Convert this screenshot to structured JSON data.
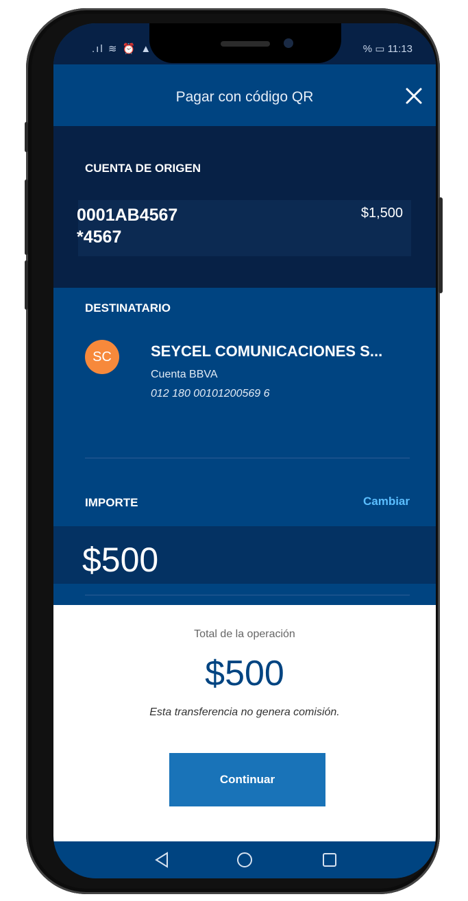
{
  "status_bar": {
    "left_icons": ".ıl ≋ ⏰ ▲",
    "right_text": "% ▭ 11:13"
  },
  "header": {
    "title": "Pagar con código QR",
    "close_icon": "close-icon"
  },
  "origin": {
    "label": "CUENTA DE ORIGEN",
    "account_number": "0001AB4567",
    "account_mask": "*4567",
    "balance": "$1,500"
  },
  "recipient": {
    "label": "DESTINATARIO",
    "initials": "SC",
    "name": "SEYCEL COMUNICACIONES S...",
    "account_type": "Cuenta BBVA",
    "clabe": "012 180 00101200569 6"
  },
  "amount": {
    "label": "IMPORTE",
    "change_label": "Cambiar",
    "value": "$500"
  },
  "summary": {
    "total_label": "Total de la operación",
    "total_value": "$500",
    "fee_note": "Esta transferencia no genera comisión.",
    "continue_label": "Continuar"
  },
  "nav": {
    "back_icon": "back-triangle-icon",
    "home_icon": "home-circle-icon",
    "recents_icon": "recents-square-icon"
  },
  "colors": {
    "navy": "#072146",
    "primary_blue": "#004481",
    "button_blue": "#1973b8",
    "link_blue": "#5bbeff",
    "avatar_orange": "#f7893b"
  }
}
